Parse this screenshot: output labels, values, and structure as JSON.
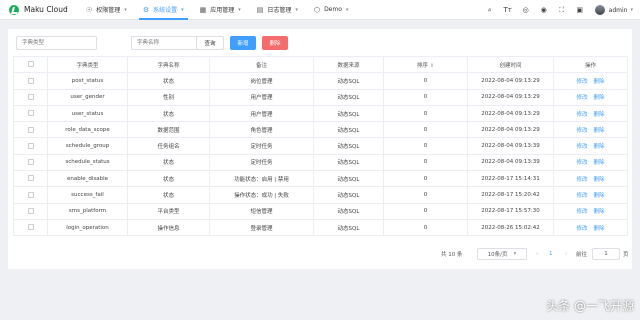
{
  "brand": {
    "name": "Maku Cloud"
  },
  "nav": [
    {
      "icon": "☉",
      "label": "权限管理",
      "active": false
    },
    {
      "icon": "⚙",
      "label": "系统设置",
      "active": true
    },
    {
      "icon": "▦",
      "label": "应用管理",
      "active": false
    },
    {
      "icon": "▤",
      "label": "日志管理",
      "active": false
    },
    {
      "icon": "⬡",
      "label": "Demo",
      "active": false
    }
  ],
  "toolbar_icons": [
    "search-icon",
    "font-size-icon",
    "language-icon",
    "github-icon",
    "fullscreen-icon",
    "settings-icon"
  ],
  "user": {
    "name": "admin"
  },
  "search": {
    "dict_type_placeholder": "字典类型",
    "dict_name_placeholder": "字典名称",
    "query_label": "查询",
    "add_label": "新增",
    "delete_label": "删除"
  },
  "table": {
    "headers": [
      "字典类型",
      "字典名称",
      "备注",
      "数据来源",
      "排序",
      "创建时间",
      "操作"
    ],
    "edit_label": "修改",
    "delete_label": "删除",
    "rows": [
      {
        "type": "post_status",
        "name": "状态",
        "remark": "岗位管理",
        "source": "动态SQL",
        "sort": "0",
        "created": "2022-08-04 09:13:29"
      },
      {
        "type": "user_gender",
        "name": "性别",
        "remark": "用户管理",
        "source": "动态SQL",
        "sort": "0",
        "created": "2022-08-04 09:13:29"
      },
      {
        "type": "user_status",
        "name": "状态",
        "remark": "用户管理",
        "source": "动态SQL",
        "sort": "0",
        "created": "2022-08-04 09:13:29"
      },
      {
        "type": "role_data_scope",
        "name": "数据范围",
        "remark": "角色管理",
        "source": "动态SQL",
        "sort": "0",
        "created": "2022-08-04 09:13:29"
      },
      {
        "type": "schedule_group",
        "name": "任务组名",
        "remark": "定时任务",
        "source": "动态SQL",
        "sort": "0",
        "created": "2022-08-04 09:13:39"
      },
      {
        "type": "schedule_status",
        "name": "状态",
        "remark": "定时任务",
        "source": "动态SQL",
        "sort": "0",
        "created": "2022-08-04 09:13:39"
      },
      {
        "type": "enable_disable",
        "name": "状态",
        "remark": "功能状态：启用 | 禁用",
        "source": "动态SQL",
        "sort": "0",
        "created": "2022-08-17 15:14:31"
      },
      {
        "type": "success_fail",
        "name": "状态",
        "remark": "操作状态：成功 | 失败",
        "source": "动态SQL",
        "sort": "0",
        "created": "2022-08-17 15:20:42"
      },
      {
        "type": "sms_platform",
        "name": "平台类型",
        "remark": "短信管理",
        "source": "动态SQL",
        "sort": "0",
        "created": "2022-08-17 15:57:30"
      },
      {
        "type": "login_operation",
        "name": "操作信息",
        "remark": "登录管理",
        "source": "动态SQL",
        "sort": "0",
        "created": "2022-08-26 15:02:42"
      }
    ]
  },
  "pagination": {
    "total_label": "共 10 条",
    "page_size_label": "10条/页",
    "current_page": "1",
    "goto_label": "前往",
    "goto_value": "1",
    "page_suffix": "页"
  },
  "watermark": "头条 @一飞开源",
  "colors": {
    "accent": "#409eff",
    "danger": "#f56c6c",
    "brand": "#1aad5b"
  }
}
